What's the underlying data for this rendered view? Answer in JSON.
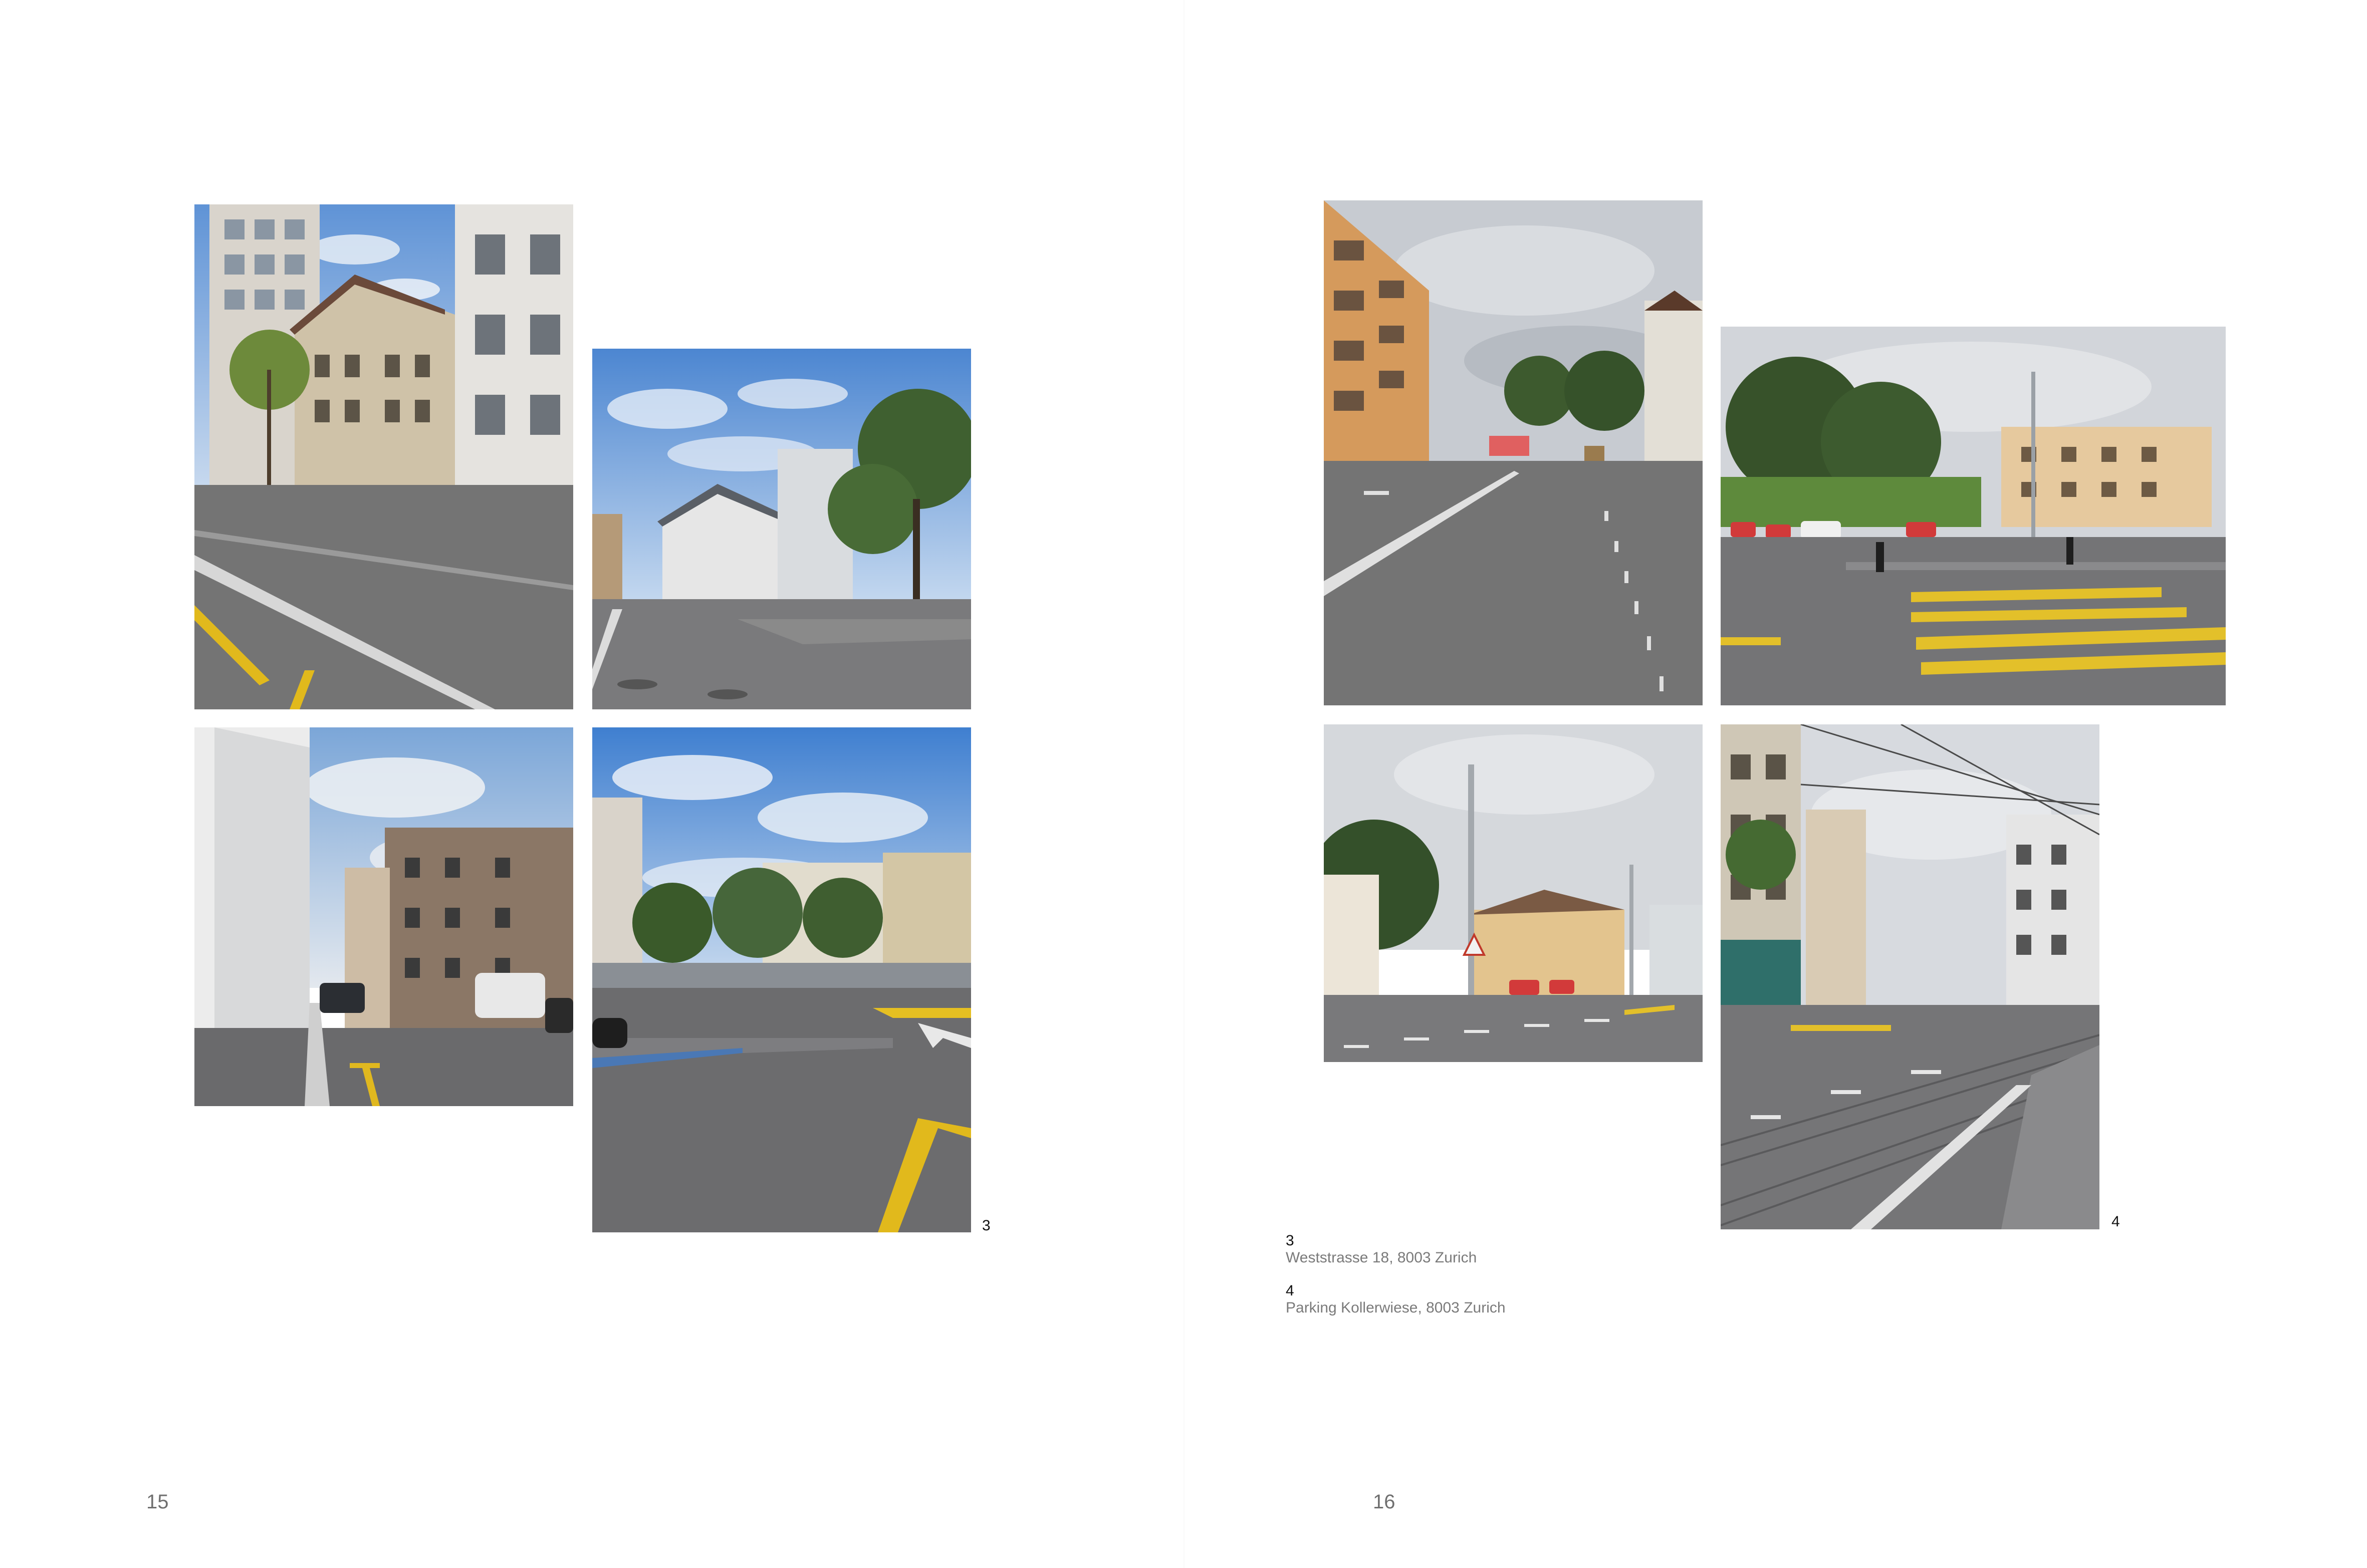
{
  "left_page": {
    "figure_number": "3",
    "page_number": "15"
  },
  "right_page": {
    "figure_number": "4",
    "page_number": "16",
    "captions": [
      {
        "number": "3",
        "text": "Weststrasse 18, 8003 Zurich"
      },
      {
        "number": "4",
        "text": "Parking Kollerwiese, 8003 Zurich"
      }
    ]
  },
  "colors": {
    "sky_blue": "#6f9fd8",
    "sky_grey": "#c9ccd1",
    "asphalt": "#6e6e70",
    "road_yellow": "#e7c22a",
    "tree_green": "#3e5a2c"
  }
}
